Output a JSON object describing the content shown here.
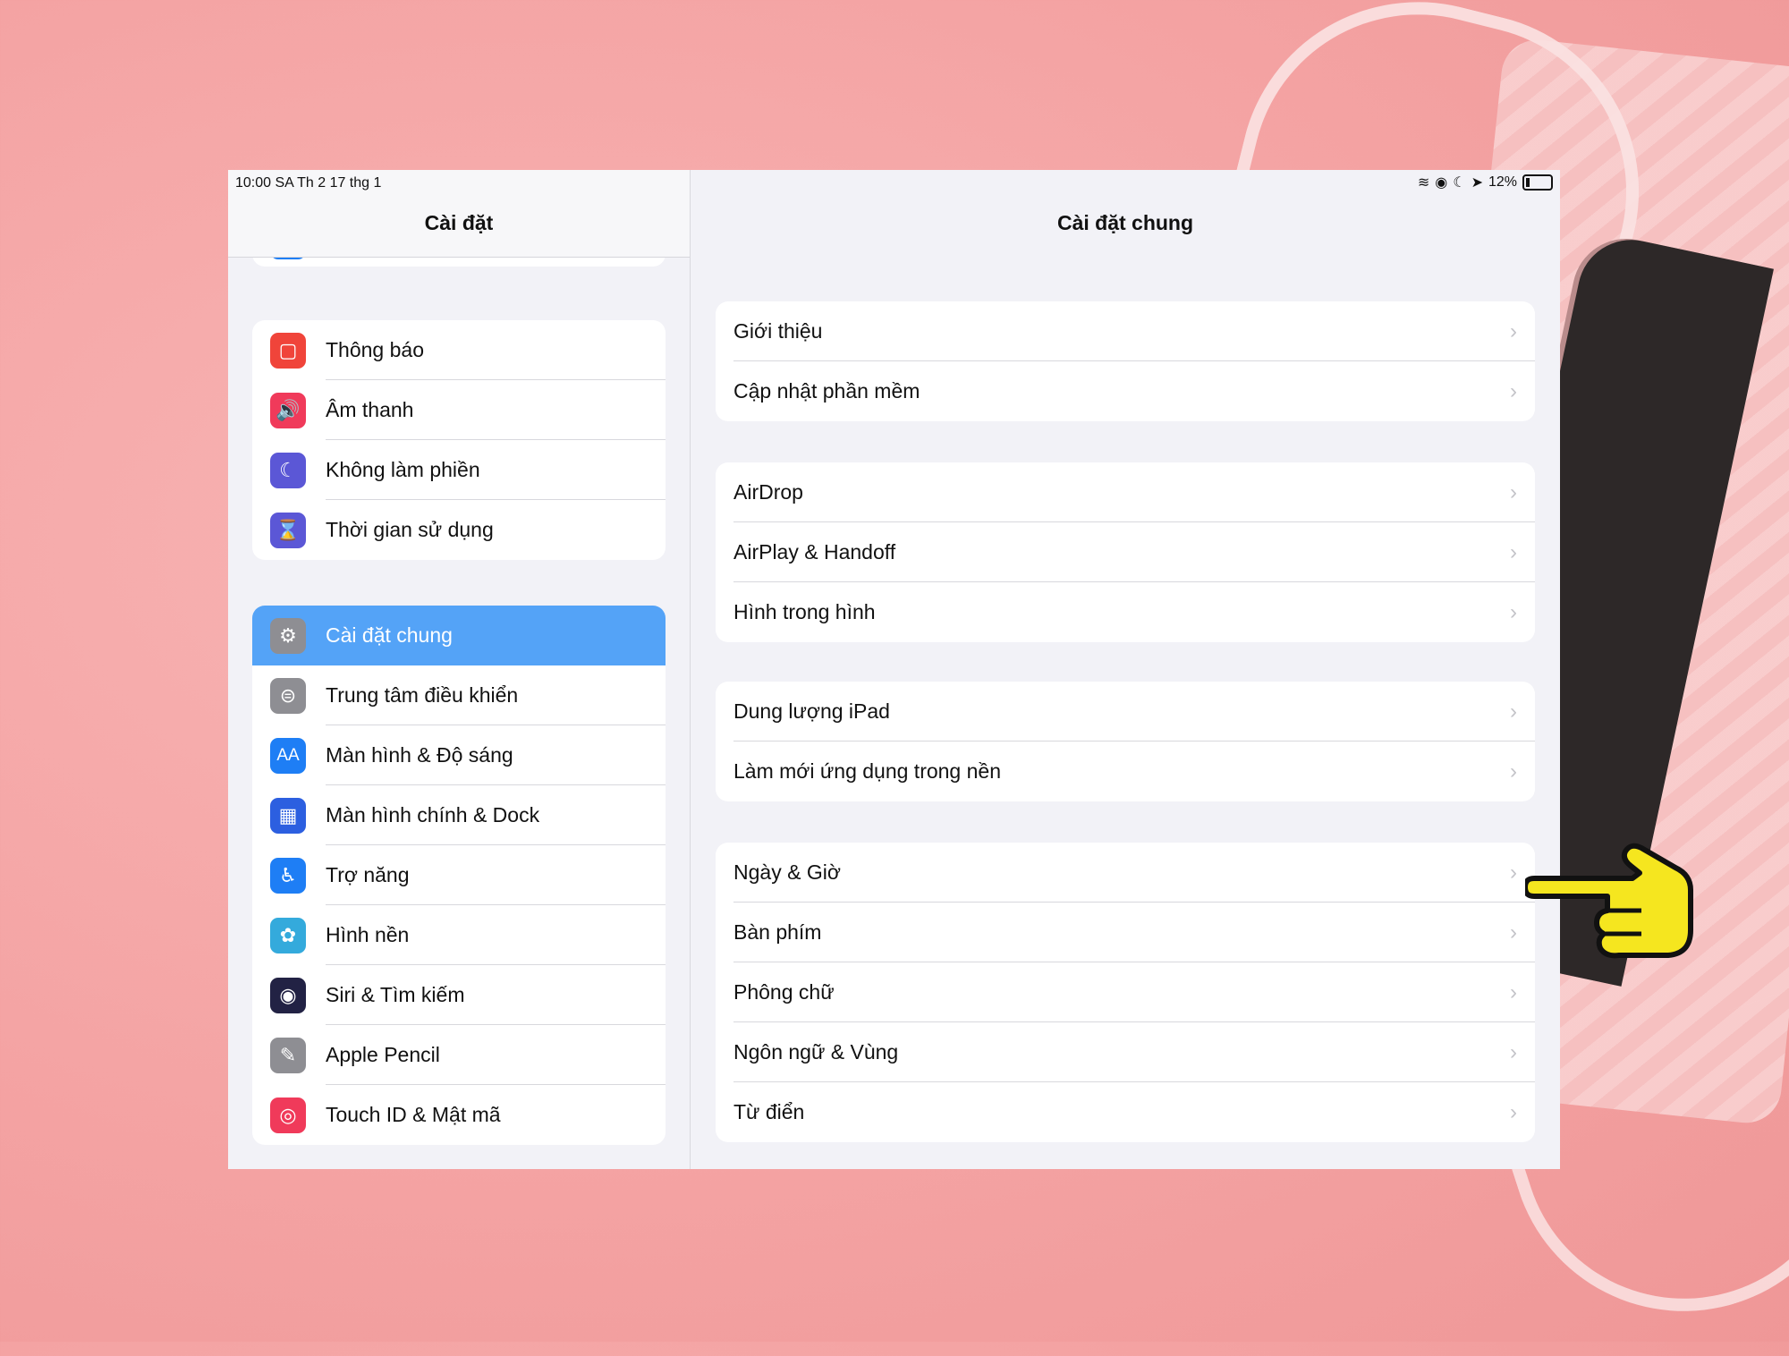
{
  "status_bar": {
    "time_date": "10:00 SA   Th 2 17 thg 1",
    "battery": "12%"
  },
  "sidebar": {
    "title": "Cài đặt",
    "group1": [
      {
        "label": "Thông báo",
        "icon": "notification-icon",
        "color": "#f0443a"
      },
      {
        "label": "Âm thanh",
        "icon": "speaker-icon",
        "color": "#f03a5a"
      },
      {
        "label": "Không làm phiền",
        "icon": "moon-icon",
        "color": "#5b57d6"
      },
      {
        "label": "Thời gian sử dụng",
        "icon": "hourglass-icon",
        "color": "#5b57d6"
      }
    ],
    "group2": [
      {
        "label": "Cài đặt chung",
        "icon": "gear-icon",
        "color": "#8e8e93",
        "selected": true
      },
      {
        "label": "Trung tâm điều khiển",
        "icon": "toggles-icon",
        "color": "#8e8e93"
      },
      {
        "label": "Màn hình & Độ sáng",
        "icon": "display-icon",
        "color": "#1e7ef5",
        "glyph": "AA"
      },
      {
        "label": "Màn hình chính & Dock",
        "icon": "grid-icon",
        "color": "#2c5fe0"
      },
      {
        "label": "Trợ năng",
        "icon": "accessibility-icon",
        "color": "#1e7ef5"
      },
      {
        "label": "Hình nền",
        "icon": "wallpaper-icon",
        "color": "#34aadc"
      },
      {
        "label": "Siri & Tìm kiếm",
        "icon": "siri-icon",
        "color": "#222244"
      },
      {
        "label": "Apple Pencil",
        "icon": "pencil-icon",
        "color": "#8e8e93"
      },
      {
        "label": "Touch ID & Mật mã",
        "icon": "fingerprint-icon",
        "color": "#f03a5a"
      }
    ]
  },
  "main": {
    "title": "Cài đặt chung",
    "groups": [
      [
        "Giới thiệu",
        "Cập nhật phần mềm"
      ],
      [
        "AirDrop",
        "AirPlay & Handoff",
        "Hình trong hình"
      ],
      [
        "Dung lượng iPad",
        "Làm mới ứng dụng trong nền"
      ],
      [
        "Ngày & Giờ",
        "Bàn phím",
        "Phông chữ",
        "Ngôn ngữ & Vùng",
        "Từ điển"
      ]
    ]
  },
  "pointer": {
    "icon": "pointing-hand-icon",
    "color": "#f5e61f"
  }
}
